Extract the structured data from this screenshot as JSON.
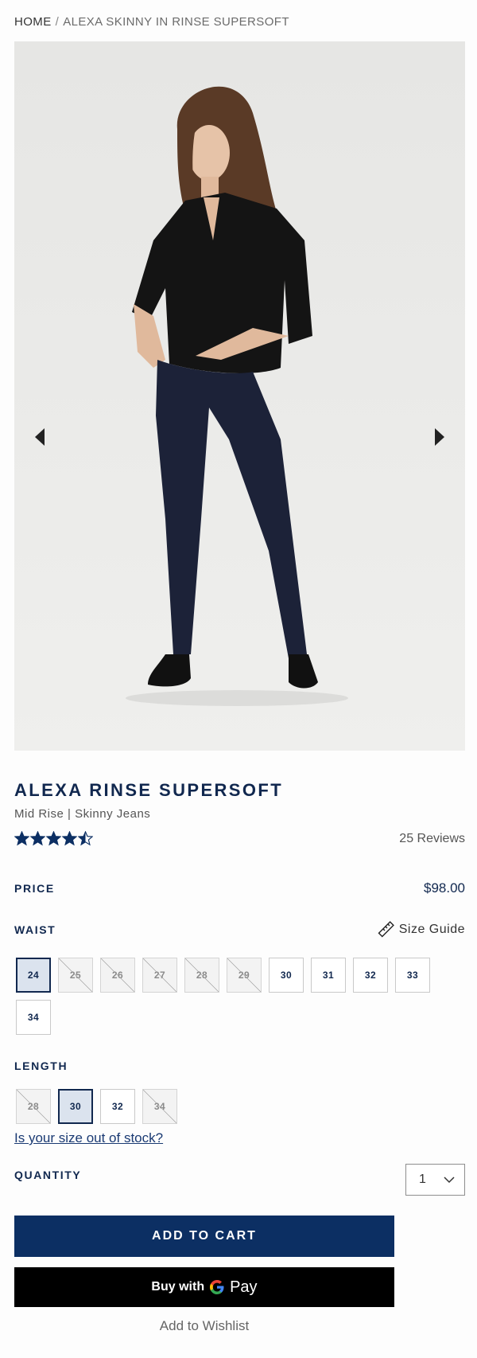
{
  "breadcrumb": {
    "home": "HOME",
    "separator": "/",
    "current": "ALEXA SKINNY IN RINSE SUPERSOFT"
  },
  "gallery": {
    "prev_icon": "chevron-left-icon",
    "next_icon": "chevron-right-icon"
  },
  "product": {
    "title": "ALEXA RINSE SUPERSOFT",
    "subtitle": "Mid Rise | Skinny Jeans",
    "rating": 4.5,
    "rating_max": 5,
    "reviews_label": "25 Reviews"
  },
  "price": {
    "label": "PRICE",
    "value": "$98.00"
  },
  "waist": {
    "label": "WAIST",
    "size_guide_label": "Size Guide",
    "sizes": [
      {
        "value": "24",
        "state": "selected"
      },
      {
        "value": "25",
        "state": "out-of-stock"
      },
      {
        "value": "26",
        "state": "out-of-stock"
      },
      {
        "value": "27",
        "state": "out-of-stock"
      },
      {
        "value": "28",
        "state": "out-of-stock"
      },
      {
        "value": "29",
        "state": "out-of-stock"
      },
      {
        "value": "30",
        "state": "available"
      },
      {
        "value": "31",
        "state": "available"
      },
      {
        "value": "32",
        "state": "available"
      },
      {
        "value": "33",
        "state": "available"
      },
      {
        "value": "34",
        "state": "available"
      }
    ]
  },
  "length": {
    "label": "LENGTH",
    "sizes": [
      {
        "value": "28",
        "state": "out-of-stock"
      },
      {
        "value": "30",
        "state": "selected"
      },
      {
        "value": "32",
        "state": "available"
      },
      {
        "value": "34",
        "state": "out-of-stock"
      }
    ]
  },
  "out_of_stock_link": "Is your size out of stock?",
  "quantity": {
    "label": "QUANTITY",
    "value": "1"
  },
  "actions": {
    "add_to_cart": "ADD TO CART",
    "buy_with": "Buy with",
    "gpay_g": "G",
    "gpay_pay": "Pay",
    "wishlist": "Add to Wishlist"
  },
  "colors": {
    "navy": "#0c2f63",
    "selected_bg": "#dbe3ee",
    "gpay_bg": "#000000"
  }
}
